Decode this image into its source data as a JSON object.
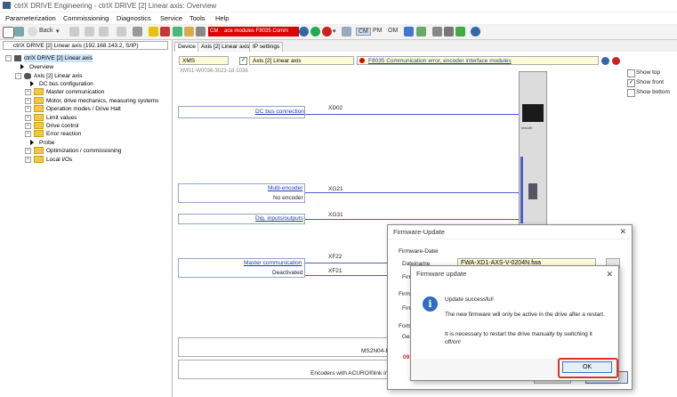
{
  "window": {
    "title": "ctrlX DRIVE Engineering - ctrlX DRIVE [2] Linear axis: Overview"
  },
  "menu": [
    "Parameterization",
    "Commissioning",
    "Diagnostics",
    "Service",
    "Tools",
    "Help"
  ],
  "toolbar": {
    "back_label": "Back",
    "error_badge_1": "CM",
    "error_badge_2": "ace modules   F8035 Comm",
    "mode_cm": "CM",
    "mode_pm": "PM",
    "mode_om": "OM"
  },
  "left": {
    "combo": "ctrlX DRIVE [2] Linear axis (192.168.143.2, S/IP)",
    "tree": [
      {
        "label": "ctrlX DRIVE [2] Linear axis",
        "level": 0,
        "kind": "root"
      },
      {
        "label": "Overview",
        "level": 1,
        "kind": "leaf"
      },
      {
        "label": "Axis [2] Linear axis",
        "level": 1,
        "kind": "axis"
      },
      {
        "label": "DC bus configuration",
        "level": 2,
        "kind": "leaf"
      },
      {
        "label": "Master communication",
        "level": 2,
        "kind": "folder"
      },
      {
        "label": "Motor, drive mechanics, measuring systems",
        "level": 2,
        "kind": "folder"
      },
      {
        "label": "Operation modes / Drive Halt",
        "level": 2,
        "kind": "folder"
      },
      {
        "label": "Limit values",
        "level": 2,
        "kind": "folder"
      },
      {
        "label": "Drive control",
        "level": 2,
        "kind": "folder"
      },
      {
        "label": "Error reaction",
        "level": 2,
        "kind": "folder"
      },
      {
        "label": "Probe",
        "level": 2,
        "kind": "leaf"
      },
      {
        "label": "Optimization / commissioning",
        "level": 2,
        "kind": "folder"
      },
      {
        "label": "Local I/Os",
        "level": 2,
        "kind": "folder"
      }
    ]
  },
  "tabs": [
    "Device",
    "Axis [2] Linear axis",
    "IP settings"
  ],
  "main": {
    "xms": "XMS",
    "axis_field": "Axis [2] Linear axis",
    "error_field": "F8035 Communication error, encoder interface modules",
    "type_code": "XMS1-W0036-3023-18-1038",
    "show_top": "Show top",
    "show_front": "Show front",
    "show_bottom": "Show bottom",
    "dc_bus_link": "DC bus connection",
    "xd02": "XD02",
    "multi_encoder_link": "Multi-encoder",
    "no_encoder": "No encoder",
    "xg21": "XG21",
    "dig_io_link": "Dig. inputs/outputs",
    "xg31": "XG31",
    "xf22": "XF22",
    "master_comm_link": "Master communication",
    "deactivated": "Deactivated",
    "xf21": "XF21",
    "ms2n_text": "MS2N04-E",
    "encoders_text": "Encoders with ACURO®link int",
    "device_brand": "rexroth"
  },
  "fw_dialog": {
    "title": "Firmware-Update",
    "section": "Firmware-Datei",
    "dateiname_label": "Dateiname",
    "file_value": "FWA-XD1-AXS-V-0204N.fwa",
    "firm_label_1": "Firm",
    "firm_label_2": "Firm",
    "firm_label_3": "Firm",
    "fort_label": "Forts",
    "gen_label": "Gen",
    "num_label": "09"
  },
  "msg_dialog": {
    "title": "Firmware update",
    "line1": "Update successful!",
    "line2": "The new firmware will only be active in the drive after a restart.",
    "line3": "It is necessary to restart the drive manually by switching it off/on!",
    "ok": "OK"
  },
  "colors": {
    "link": "#1f3aa8",
    "error_red": "#e00000",
    "highlight": "#fffdd8",
    "annotation": "#d9342b"
  }
}
